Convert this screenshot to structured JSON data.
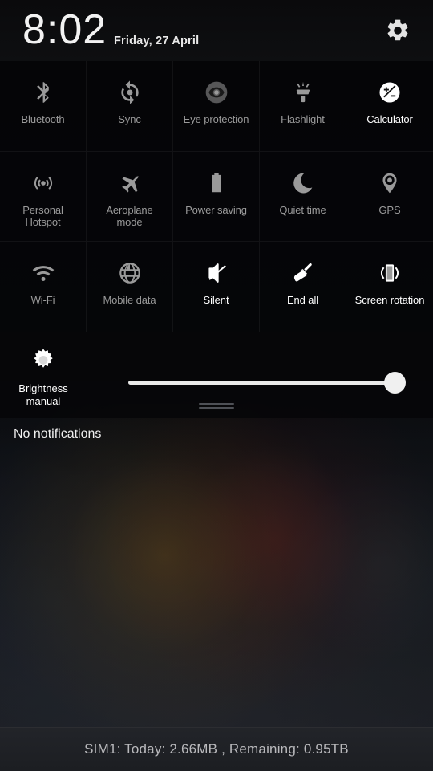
{
  "header": {
    "time": "8:02",
    "date": "Friday, 27 April",
    "settings_icon": "gear-icon"
  },
  "tiles": [
    {
      "label": "Bluetooth",
      "icon": "bluetooth-icon",
      "active": false
    },
    {
      "label": "Sync",
      "icon": "sync-icon",
      "active": false
    },
    {
      "label": "Eye protection",
      "icon": "eye-protection-icon",
      "active": false
    },
    {
      "label": "Flashlight",
      "icon": "flashlight-icon",
      "active": false
    },
    {
      "label": "Calculator",
      "icon": "calculator-icon",
      "active": true
    },
    {
      "label": "Personal\nHotspot",
      "icon": "hotspot-icon",
      "active": false
    },
    {
      "label": "Aeroplane\nmode",
      "icon": "aeroplane-icon",
      "active": false
    },
    {
      "label": "Power saving",
      "icon": "battery-icon",
      "active": false
    },
    {
      "label": "Quiet time",
      "icon": "moon-icon",
      "active": false
    },
    {
      "label": "GPS",
      "icon": "location-pin-icon",
      "active": false
    },
    {
      "label": "Wi-Fi",
      "icon": "wifi-icon",
      "active": false
    },
    {
      "label": "Mobile data",
      "icon": "globe-icon",
      "active": false
    },
    {
      "label": "Silent",
      "icon": "speaker-mute-icon",
      "active": true
    },
    {
      "label": "End all",
      "icon": "broom-icon",
      "active": true
    },
    {
      "label": "Screen rotation",
      "icon": "screen-rotation-icon",
      "active": true
    }
  ],
  "brightness": {
    "label": "Brightness\nmanual",
    "icon": "brightness-sun-icon",
    "value_percent": 93
  },
  "notifications": {
    "empty_text": "No notifications"
  },
  "bottom": {
    "data_usage": "SIM1: Today:  2.66MB , Remaining:  0.95TB"
  }
}
